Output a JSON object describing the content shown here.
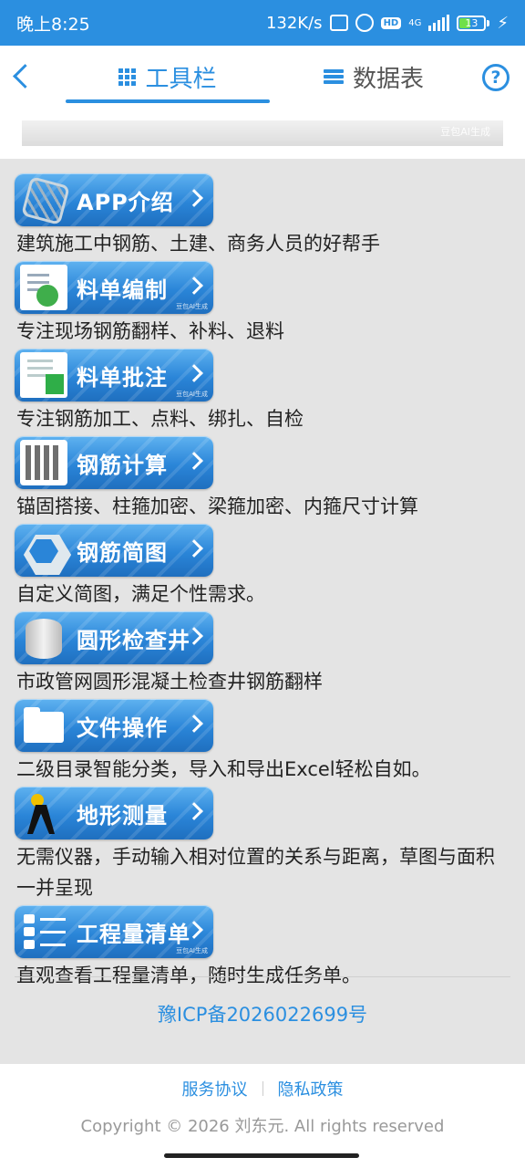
{
  "status_bar": {
    "time": "晚上8:25",
    "net_speed": "132K/s",
    "net_type": "4G",
    "hd": "HD",
    "battery": "13"
  },
  "header": {
    "tabs": [
      {
        "label": "工具栏",
        "active": true
      },
      {
        "label": "数据表",
        "active": false
      }
    ],
    "help": "?"
  },
  "banner": {
    "watermark": "豆包AI生成"
  },
  "items": [
    {
      "label": "APP介绍",
      "icon": "polyhedron-icon",
      "desc": "建筑施工中钢筋、土建、商务人员的好帮手"
    },
    {
      "label": "料单编制",
      "icon": "document-icon",
      "desc": "专注现场钢筋翻样、补料、退料",
      "ai": "豆包AI生成"
    },
    {
      "label": "料单批注",
      "icon": "annotation-icon",
      "desc": "专注钢筋加工、点料、绑扎、自检",
      "ai": "豆包AI生成"
    },
    {
      "label": "钢筋计算",
      "icon": "calculator-icon",
      "desc": "锚固搭接、柱箍加密、梁箍加密、内箍尺寸计算"
    },
    {
      "label": "钢筋简图",
      "icon": "hexagon-icon",
      "desc": "自定义简图，满足个性需求。"
    },
    {
      "label": "圆形检查井",
      "icon": "manhole-icon",
      "desc": "市政管网圆形混凝土检查井钢筋翻样"
    },
    {
      "label": "文件操作",
      "icon": "folder-icon",
      "desc": "二级目录智能分类，导入和导出Excel轻松自如。"
    },
    {
      "label": "地形测量",
      "icon": "surveyor-icon",
      "desc": "无需仪器，手动输入相对位置的关系与距离，草图与面积一并呈现"
    },
    {
      "label": "工程量清单",
      "icon": "list-icon",
      "desc": "直观查看工程量清单，随时生成任务单。",
      "ai": "豆包AI生成"
    }
  ],
  "icp": "豫ICP备2026022699号",
  "footer": {
    "links": [
      "服务协议",
      "隐私政策"
    ],
    "copyright": "Copyright © 2026 刘东元. All rights reserved"
  },
  "colors": {
    "accent": "#2b8fe0",
    "page_bg": "#e4e4e4"
  }
}
